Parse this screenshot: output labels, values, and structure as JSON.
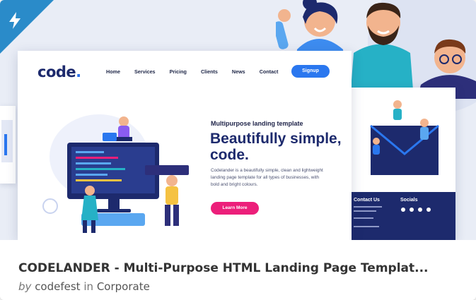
{
  "badge": {
    "icon": "lightning-bolt-icon",
    "color": "#2a8bc9"
  },
  "preview": {
    "logo_text": "code",
    "logo_dot": ".",
    "nav": [
      "Home",
      "Services",
      "Pricing",
      "Clients",
      "News",
      "Contact"
    ],
    "signup_label": "Signup",
    "kicker": "Multipurpose landing template",
    "headline": "Beautifully simple, code.",
    "body": "Codelander is a beautifully simple, clean and lightweight landing page template for all types of businesses, with bold and bright colours.",
    "cta_label": "Learn More",
    "footer": {
      "contact_heading": "Contact Us",
      "socials_heading": "Socials"
    },
    "colors": {
      "navy": "#1d2a6d",
      "blue": "#2a77ef",
      "pink": "#ec1f7a"
    }
  },
  "item": {
    "title": "CODELANDER - Multi-Purpose HTML Landing Page Templat...",
    "by_label": "by",
    "author": "codefest",
    "in_label": "in",
    "category": "Corporate"
  }
}
